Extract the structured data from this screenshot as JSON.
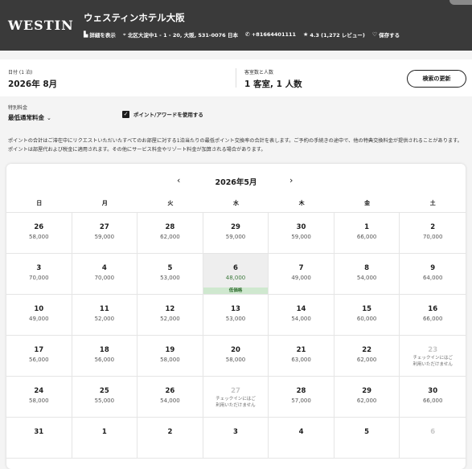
{
  "header": {
    "logo": "WESTIN",
    "hotel_name": "ウェスティンホテル大阪",
    "details_link": "詳細を表示",
    "address": "北区大淀中1 - 1 - 20, 大阪, 531-0076 日本",
    "phone": "+81664401111",
    "rating": "4.3 (1,272 レビュー)",
    "save_label": "保存する"
  },
  "search": {
    "dates_label": "日付 (1 泊)",
    "dates_value": "2026年 8月",
    "guests_label": "客室数と人数",
    "guests_value": "1 客室, 1 人数",
    "update_button": "検索の更新"
  },
  "rate": {
    "label": "特別料金",
    "value": "最低通常料金",
    "points_checkbox_label": "ポイント/アワードを使用する",
    "points_checked": true
  },
  "note": "ポイントの合計はご滞在中にリクエストいただいたすべてのお部屋に対する1泊当たりの最低ポイント交換率の合計を表します。ご予約の手続きの途中で、他の特典交換料金が提供されることがあります。ポイントは部屋代および税金に適用されます。その他にサービス料金やリゾート料金が加算される場合があります。",
  "calendar": {
    "month": "2026年5月",
    "prev": "‹",
    "next": "›",
    "weekdays": [
      "日",
      "月",
      "火",
      "水",
      "木",
      "金",
      "土"
    ],
    "low_badge": "低価格",
    "days": [
      {
        "d": "26",
        "p": "58,000"
      },
      {
        "d": "27",
        "p": "59,000"
      },
      {
        "d": "28",
        "p": "62,000"
      },
      {
        "d": "29",
        "p": "59,000"
      },
      {
        "d": "30",
        "p": "59,000"
      },
      {
        "d": "1",
        "p": "66,000"
      },
      {
        "d": "2",
        "p": "70,000"
      },
      {
        "d": "3",
        "p": "70,000"
      },
      {
        "d": "4",
        "p": "70,000"
      },
      {
        "d": "5",
        "p": "53,000"
      },
      {
        "d": "6",
        "p": "48,000",
        "low": true
      },
      {
        "d": "7",
        "p": "49,000"
      },
      {
        "d": "8",
        "p": "54,000"
      },
      {
        "d": "9",
        "p": "64,000"
      },
      {
        "d": "10",
        "p": "49,000"
      },
      {
        "d": "11",
        "p": "52,000"
      },
      {
        "d": "12",
        "p": "52,000"
      },
      {
        "d": "13",
        "p": "53,000"
      },
      {
        "d": "14",
        "p": "54,000"
      },
      {
        "d": "15",
        "p": "60,000"
      },
      {
        "d": "16",
        "p": "66,000"
      },
      {
        "d": "17",
        "p": "56,000"
      },
      {
        "d": "18",
        "p": "56,000"
      },
      {
        "d": "19",
        "p": "58,000"
      },
      {
        "d": "20",
        "p": "58,000"
      },
      {
        "d": "21",
        "p": "63,000"
      },
      {
        "d": "22",
        "p": "62,000"
      },
      {
        "d": "23",
        "na": "チェックインにはご利用いただけません"
      },
      {
        "d": "24",
        "p": "58,000"
      },
      {
        "d": "25",
        "p": "55,000"
      },
      {
        "d": "26",
        "p": "54,000"
      },
      {
        "d": "27",
        "na": "チェックインにはご利用いただけません"
      },
      {
        "d": "28",
        "p": "57,000"
      },
      {
        "d": "29",
        "p": "62,000"
      },
      {
        "d": "30",
        "p": "66,000"
      },
      {
        "d": "31",
        "p": ""
      },
      {
        "d": "1",
        "p": ""
      },
      {
        "d": "2",
        "p": ""
      },
      {
        "d": "3",
        "p": ""
      },
      {
        "d": "4",
        "p": ""
      },
      {
        "d": "5",
        "p": ""
      },
      {
        "d": "6",
        "p": "",
        "dis": true
      }
    ]
  }
}
